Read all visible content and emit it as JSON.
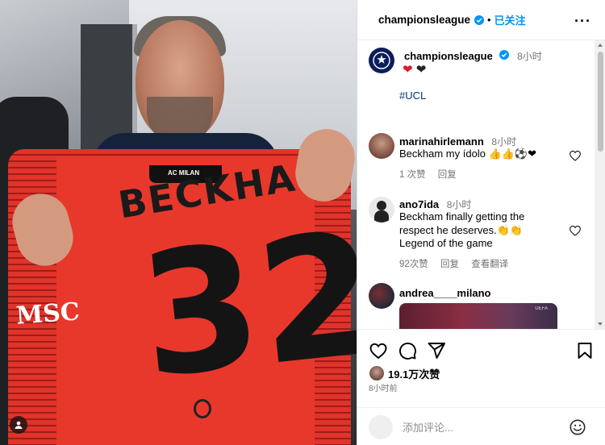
{
  "header": {
    "username": "championsleague",
    "separator": "•",
    "follow_label": "已关注",
    "more_label": "···"
  },
  "caption": {
    "username": "championsleague",
    "time": "8小时",
    "hearts": [
      "❤",
      "❤"
    ],
    "hashtag": "#UCL"
  },
  "photo": {
    "jersey_name": "BECKHAM",
    "jersey_number": "32",
    "sponsor": "MSC",
    "club_label": "AC MILAN"
  },
  "comments": [
    {
      "username": "marinahirlemann",
      "time": "8小时",
      "text": "Beckham my ídolo 👍👍⚽❤",
      "likes": "1 次赞",
      "reply": "回复"
    },
    {
      "username": "ano7ida",
      "time": "8小时",
      "text_lines": [
        "Beckham finally getting the",
        "respect he deserves.👏👏",
        "Legend of the game"
      ],
      "likes": "92次赞",
      "reply": "回复",
      "translate": "查看翻译"
    },
    {
      "username": "andrea____milano",
      "thumbnail_label": "UEFA"
    }
  ],
  "footer": {
    "likes_count": "19.1万次赞",
    "post_time": "8小时前",
    "comment_placeholder": "添加评论...",
    "icons": [
      "heart-icon",
      "comment-icon",
      "share-icon",
      "bookmark-icon",
      "emoji-icon"
    ]
  },
  "colors": {
    "accent": "#0095f6",
    "hashtag": "#00376b",
    "secondary_text": "#737373",
    "heart_red": "#e0192b",
    "ucl_navy": "#0b1e5b"
  }
}
